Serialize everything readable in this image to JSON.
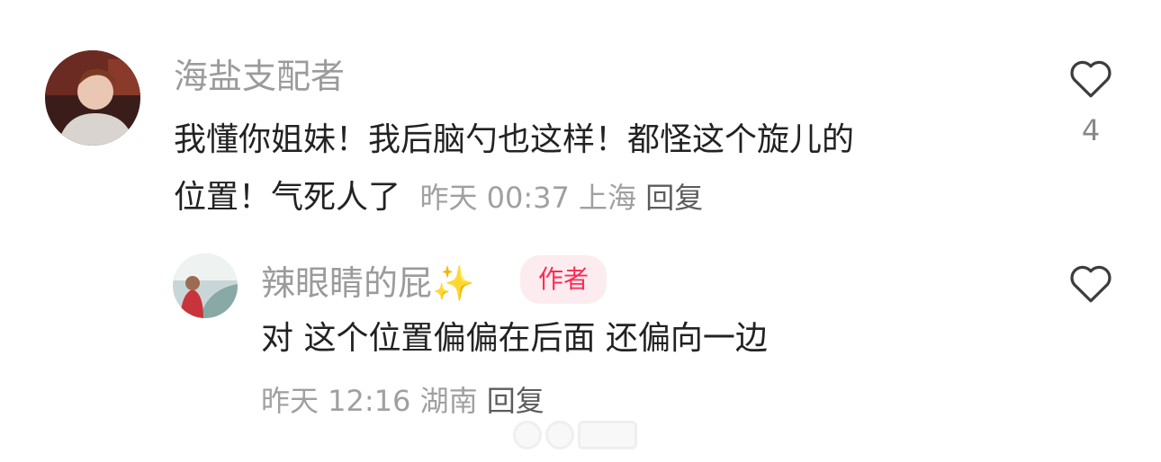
{
  "comments": [
    {
      "username": "海盐支配者",
      "text_line1": "我懂你姐妹！我后脑勺也这样！都怪这个旋儿的",
      "text_line2": "位置！气死人了",
      "time": "昨天 00:37",
      "location": "上海",
      "reply_label": "回复",
      "like_count": "4"
    },
    {
      "username": "辣眼睛的屁✨",
      "author_badge": "作者",
      "text": "对 这个位置偏偏在后面 还偏向一边",
      "time": "昨天 12:16",
      "location": "湖南",
      "reply_label": "回复",
      "like_count": ""
    }
  ],
  "icons": {
    "like": "heart-outline-icon"
  },
  "colors": {
    "author_badge_text": "#ff2a55",
    "author_badge_bg": "#fdecef",
    "username": "#9b9b9b"
  }
}
